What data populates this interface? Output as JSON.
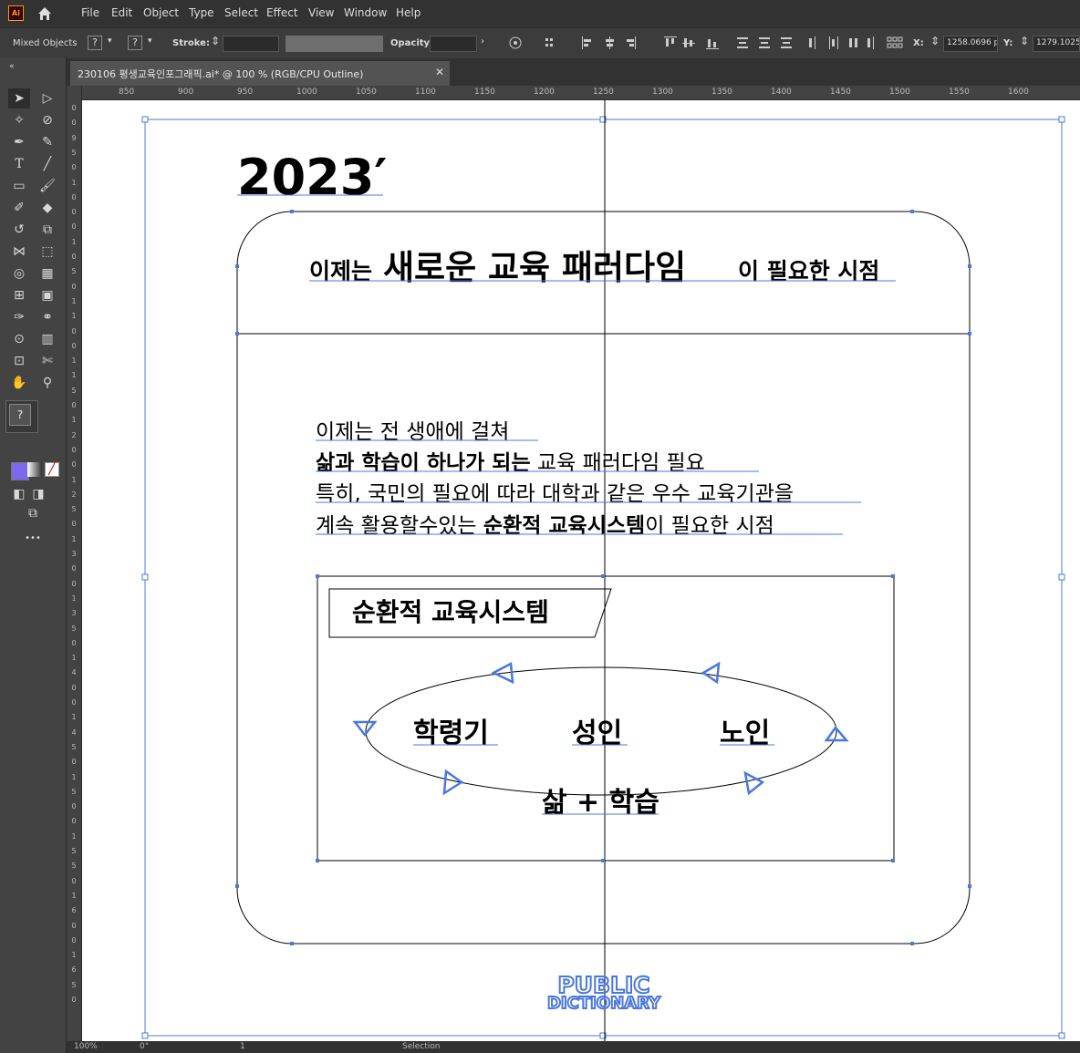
{
  "app": {
    "logo": "Ai"
  },
  "menu": [
    "File",
    "Edit",
    "Object",
    "Type",
    "Select",
    "Effect",
    "View",
    "Window",
    "Help"
  ],
  "control": {
    "selection_label": "Mixed Objects",
    "fill_q": "?",
    "stroke_q": "?",
    "stroke_label": "Stroke:",
    "opacity_label": "Opacity:",
    "x_label": "X:",
    "x_value": "1258.0696 p",
    "y_label": "Y:",
    "y_value": "1279.1025 p"
  },
  "document": {
    "tab_title": "230106 평생교육인포그래픽.ai* @ 100 % (RGB/CPU Outline)",
    "close": "✕"
  },
  "ruler_h": [
    "850",
    "900",
    "950",
    "1000",
    "1050",
    "1100",
    "1150",
    "1200",
    "1250",
    "1300",
    "1350",
    "1400",
    "1450",
    "1500",
    "1550",
    "1600"
  ],
  "ruler_v": [
    "0",
    "0",
    "9",
    "5",
    "0",
    "1",
    "0",
    "0",
    "0",
    "1",
    "0",
    "5",
    "0",
    "1",
    "1",
    "0",
    "0",
    "1",
    "1",
    "5",
    "0",
    "1",
    "2",
    "0",
    "0",
    "1",
    "2",
    "5",
    "0",
    "1",
    "3",
    "0",
    "0",
    "1",
    "3",
    "5",
    "0",
    "1",
    "4",
    "0",
    "0",
    "1",
    "4",
    "5",
    "0",
    "1",
    "5",
    "0",
    "0",
    "1",
    "5",
    "5",
    "0",
    "1",
    "6",
    "0",
    "0",
    "1",
    "6",
    "5",
    "0"
  ],
  "tools": {
    "help_q": "?",
    "more": "•••"
  },
  "art": {
    "year": "2023′",
    "headline_pre": "이제는",
    "headline_big": "새로운 교육 패러다임",
    "headline_post": "이 필요한 시점",
    "body_line1": "이제는 전 생애에 걸쳐",
    "body_line2a": "삶과 학습이 하나가 되는",
    "body_line2b": " 교육 패러다임 필요",
    "body_line3": "특히, 국민의 필요에 따라 대학과 같은 우수 교육기관을",
    "body_line4a": "계속 활용할수있는 ",
    "body_line4b": "순환적 교육시스템",
    "body_line4c": "이 필요한 시점",
    "system_title": "순환적 교육시스템",
    "stage1": "학령기",
    "stage2": "성인",
    "stage3": "노인",
    "cycle_label": "삶 + 학습",
    "logo_line1": "PUBLIC",
    "logo_line2": "DICTIONARY"
  },
  "status": {
    "zoom": "100%",
    "rotation": "0°",
    "artboard": "1",
    "mode": "Selection"
  },
  "colors": {
    "selection": "#4a78e0",
    "outline": "#000000",
    "chrome_dark": "#323232",
    "chrome_mid": "#434343"
  }
}
